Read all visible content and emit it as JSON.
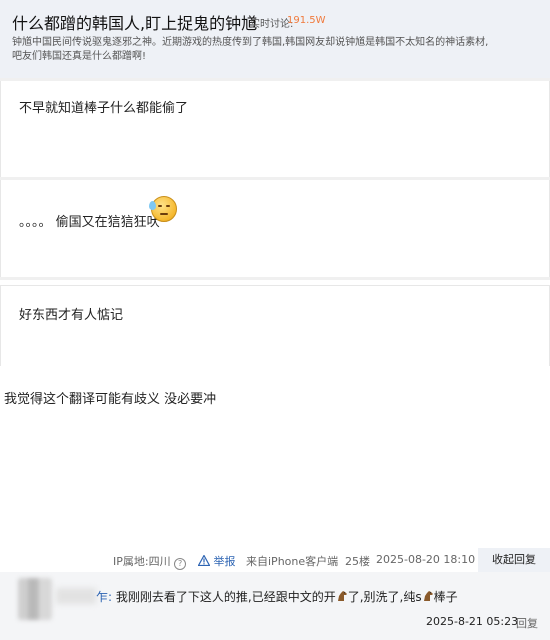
{
  "topic": {
    "title": "什么都蹭的韩国人,盯上捉鬼的钟馗",
    "discuss_label": "实时讨论:",
    "discuss_count": "191.5W",
    "description": "钟馗中国民间传说驱鬼逐邪之神。近期游戏的热度传到了韩国,韩国网友却说钟馗是韩国不太知名的神话素材,吧友们韩国还真是什么都蹭啊!"
  },
  "comments": [
    {
      "text": "不早就知道棒子什么都能偷了"
    },
    {
      "text": "。。。。 偷国又在狺狺狂吠",
      "emoji": "sweat-smile-emoji"
    },
    {
      "text": "好东西才有人惦记"
    }
  ],
  "reply": {
    "text": "我觉得这个翻译可能有歧义 没必要冲",
    "ip": "IP属地:四川",
    "report": "举报",
    "source": "来自iPhone客户端",
    "floor": "25楼",
    "time": "2025-08-20 18:10",
    "collapse": "收起回复"
  },
  "subreply": {
    "prefix": "乍:",
    "text_part1": "我刚刚去看了下这人的推,已经跟中文的开",
    "text_part2": "了,别洗了,纯s",
    "text_part3": "棒子",
    "time": "2025-8-21 05:23",
    "reply_label": "回复"
  }
}
